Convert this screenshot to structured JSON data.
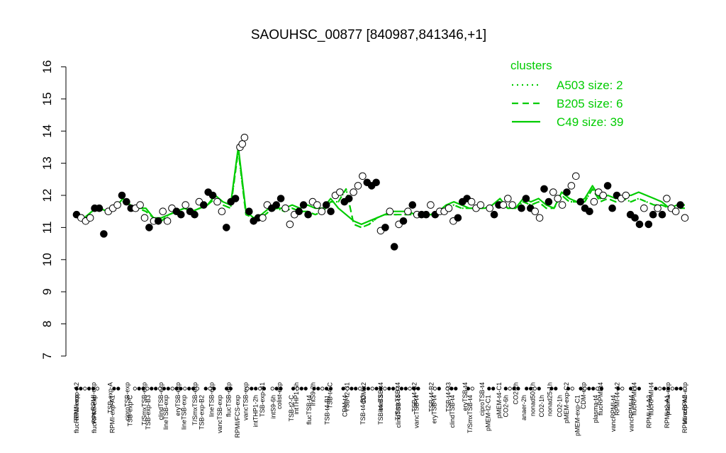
{
  "chart_data": {
    "type": "line",
    "title": "SAOUHSC_00877 [840987,841346,+1]",
    "xlabel": "",
    "ylabel": "",
    "ylim": [
      7,
      16
    ],
    "yticks": [
      7,
      8,
      9,
      10,
      11,
      12,
      13,
      14,
      15,
      16
    ],
    "grid": false,
    "legend": {
      "title": "clusters",
      "position": "top-right",
      "color": "#00cc00",
      "entries": [
        {
          "label": "A503 size: 2",
          "style": "dotted"
        },
        {
          "label": "B205 size: 6",
          "style": "dashed"
        },
        {
          "label": "C49 size: 39",
          "style": "solid"
        }
      ]
    },
    "top_labels": [
      "RPMI-exp-A2",
      "vancRPMI-exp",
      "TSB-exp-A",
      "ciproTSB-exp",
      "T/SmxTSB-exp",
      "clindTSB-exp",
      "eryTSB-exp",
      "T/SmxTSB-exp",
      "lineTSB-exp",
      "flucTSB-exp",
      "vancTSB-exp",
      "TSB-exp-B1",
      "colist-exp",
      "intTHP1-6h",
      "intS9-2h",
      "TSB-t4-C",
      "TSB-t2-B1",
      "CDM-t2",
      "lineTSB-t4",
      "T/SmxTSB-t4",
      "TSB-t4-B2",
      "TSB-t4-B2",
      "TSB-t4-B3",
      "eryTSB-t4",
      "ciproTSB-t4",
      "pMEM-t4-C1",
      "CO2-2h",
      "nonad50-1h",
      "nonad25-1h",
      "pMEM-exp-C2",
      "CDM-exp",
      "flucRPMI-t4",
      "RPMI-t4-A2",
      "flucRPMI-t4",
      "flucRPMI-t4",
      "plasma-exp",
      "vancRPMI-exp"
    ],
    "bottom_labels": [
      "flucRPMI-exp",
      "flucRPMI-exp",
      "RPMI-exp-A1",
      "TSB-exp-C",
      "TSB-exp-B3",
      "lineTSB-exp",
      "lineTSB-exp",
      "TSB-exp-B2",
      "vancTSB-exp",
      "RPMI/FCS-exp",
      "intTHP1-2h",
      "intS9-6h",
      "TSB-t2-C",
      "flucTSB-t4",
      "TSB-t4-B1",
      "CDM-t4",
      "TSB-t4-B3",
      "TSB-t4-B3",
      "clindTSB-t4",
      "vancTSB-t4",
      "eryTSB-t4",
      "clindTSB-t4",
      "T/SmxTSB-t4",
      "pMEM-t2-C1",
      "CO2-6h",
      "anaer-2h",
      "CO2-1h",
      "CO2-1h",
      "pMEM-exp-C1",
      "plasma-t4",
      "vancRPMI-t4",
      "vancRPMI-t4",
      "RPMI-t4-A2",
      "RPMI-t2-A1",
      "RPMI-exp-A2"
    ],
    "series": [
      {
        "style": "solid",
        "values": [
          11.4,
          11.3,
          11.5,
          11.6,
          11.5,
          11.6,
          11.9,
          11.7,
          11.6,
          11.6,
          11.3,
          11.3,
          11.4,
          11.5,
          11.6,
          11.5,
          11.6,
          11.7,
          12.0,
          11.8,
          11.7,
          13.5,
          11.5,
          11.3,
          11.4,
          11.6,
          11.6,
          11.6,
          11.7,
          11.6,
          11.7,
          11.6,
          11.6,
          11.9,
          11.6,
          11.4,
          11.2,
          11.1,
          11.2,
          11.3,
          11.4,
          11.5,
          11.5,
          11.5,
          11.4,
          11.4,
          11.4,
          11.5,
          11.7,
          11.8,
          11.7,
          11.6,
          11.6,
          11.6,
          11.7,
          11.9,
          11.6,
          11.6,
          11.9,
          11.8,
          11.9,
          11.7,
          11.6,
          12.1,
          11.9,
          11.8,
          11.9,
          12.3,
          11.9,
          12.0,
          11.9,
          12.0,
          12.0,
          12.1,
          12.0,
          11.9,
          11.8,
          11.6,
          11.7,
          11.7
        ]
      },
      {
        "style": "dashed",
        "values": [
          11.4,
          11.3,
          11.5,
          11.6,
          11.5,
          11.6,
          11.8,
          11.7,
          11.6,
          11.5,
          11.3,
          11.2,
          11.4,
          11.5,
          11.6,
          11.5,
          11.6,
          11.7,
          11.9,
          11.7,
          11.6,
          13.4,
          11.4,
          11.3,
          11.3,
          11.5,
          11.6,
          11.5,
          11.6,
          11.5,
          11.5,
          11.4,
          11.5,
          11.8,
          11.8,
          12.2,
          11.1,
          11.0,
          11.1,
          11.3,
          11.4,
          11.4,
          11.4,
          11.4,
          11.4,
          11.4,
          11.4,
          11.5,
          11.6,
          11.7,
          11.6,
          11.6,
          11.6,
          11.6,
          11.6,
          11.8,
          11.6,
          11.6,
          11.8,
          11.7,
          11.8,
          11.6,
          11.6,
          12.0,
          11.8,
          11.8,
          11.8,
          12.2,
          11.8,
          11.9,
          11.8,
          11.9,
          11.8,
          11.9,
          11.8,
          11.7,
          11.7,
          11.6,
          11.6,
          11.6
        ]
      },
      {
        "style": "dotted",
        "values": [
          11.4,
          11.3,
          11.5,
          11.6,
          11.5,
          11.6,
          11.8,
          11.7,
          11.6,
          11.5,
          11.3,
          11.2,
          11.4,
          11.5,
          11.6,
          11.5,
          11.6,
          11.7,
          11.9,
          11.7,
          11.6,
          13.4,
          11.4,
          11.3,
          11.3,
          11.5,
          11.6,
          11.5,
          11.6,
          11.5,
          11.5,
          11.4,
          11.5,
          11.8,
          11.8,
          12.2,
          11.1,
          11.0,
          11.1,
          11.3,
          11.4,
          11.4,
          11.4,
          11.4,
          11.4,
          11.4,
          11.4,
          11.5,
          11.6,
          11.7,
          11.6,
          11.6,
          11.6,
          11.6,
          11.6,
          11.8,
          11.6,
          11.6,
          11.8,
          11.7,
          11.8,
          11.6,
          11.6,
          12.0,
          11.8,
          11.8,
          11.8,
          12.2,
          11.8,
          11.9,
          11.8,
          11.9,
          11.8,
          11.9,
          11.8,
          11.7,
          11.7,
          11.6,
          11.6,
          11.6
        ]
      }
    ],
    "points": [
      {
        "x": 1,
        "y": 11.4,
        "f": 1
      },
      {
        "x": 2,
        "y": 11.3,
        "f": 0
      },
      {
        "x": 3,
        "y": 11.2,
        "f": 0
      },
      {
        "x": 4,
        "y": 11.3,
        "f": 0
      },
      {
        "x": 5,
        "y": 11.6,
        "f": 1
      },
      {
        "x": 6,
        "y": 11.6,
        "f": 1
      },
      {
        "x": 7,
        "y": 10.8,
        "f": 1
      },
      {
        "x": 8,
        "y": 11.5,
        "f": 0
      },
      {
        "x": 9,
        "y": 11.6,
        "f": 0
      },
      {
        "x": 10,
        "y": 11.7,
        "f": 0
      },
      {
        "x": 11,
        "y": 12.0,
        "f": 1
      },
      {
        "x": 12,
        "y": 11.8,
        "f": 1
      },
      {
        "x": 13,
        "y": 11.6,
        "f": 1
      },
      {
        "x": 14,
        "y": 11.6,
        "f": 0
      },
      {
        "x": 15,
        "y": 11.7,
        "f": 0
      },
      {
        "x": 16,
        "y": 11.3,
        "f": 0
      },
      {
        "x": 17,
        "y": 11.0,
        "f": 1
      },
      {
        "x": 18,
        "y": 11.2,
        "f": 0
      },
      {
        "x": 19,
        "y": 11.2,
        "f": 1
      },
      {
        "x": 20,
        "y": 11.5,
        "f": 0
      },
      {
        "x": 21,
        "y": 11.2,
        "f": 0
      },
      {
        "x": 22,
        "y": 11.6,
        "f": 0
      },
      {
        "x": 23,
        "y": 11.5,
        "f": 1
      },
      {
        "x": 24,
        "y": 11.4,
        "f": 1
      },
      {
        "x": 25,
        "y": 11.7,
        "f": 0
      },
      {
        "x": 26,
        "y": 11.5,
        "f": 1
      },
      {
        "x": 27,
        "y": 11.4,
        "f": 1
      },
      {
        "x": 28,
        "y": 11.8,
        "f": 0
      },
      {
        "x": 29,
        "y": 11.7,
        "f": 1
      },
      {
        "x": 30,
        "y": 12.1,
        "f": 1
      },
      {
        "x": 31,
        "y": 12.0,
        "f": 1
      },
      {
        "x": 32,
        "y": 11.8,
        "f": 0
      },
      {
        "x": 33,
        "y": 11.5,
        "f": 0
      },
      {
        "x": 34,
        "y": 11.0,
        "f": 1
      },
      {
        "x": 35,
        "y": 11.8,
        "f": 1
      },
      {
        "x": 36,
        "y": 11.9,
        "f": 1
      },
      {
        "x": 37,
        "y": 13.5,
        "f": 0
      },
      {
        "x": 37.5,
        "y": 13.6,
        "f": 0
      },
      {
        "x": 38,
        "y": 13.8,
        "f": 0
      },
      {
        "x": 39,
        "y": 11.5,
        "f": 1
      },
      {
        "x": 40,
        "y": 11.2,
        "f": 1
      },
      {
        "x": 41,
        "y": 11.3,
        "f": 1
      },
      {
        "x": 42,
        "y": 11.3,
        "f": 0
      },
      {
        "x": 43,
        "y": 11.7,
        "f": 0
      },
      {
        "x": 44,
        "y": 11.6,
        "f": 1
      },
      {
        "x": 45,
        "y": 11.7,
        "f": 1
      },
      {
        "x": 46,
        "y": 11.9,
        "f": 1
      },
      {
        "x": 47,
        "y": 11.6,
        "f": 0
      },
      {
        "x": 48,
        "y": 11.1,
        "f": 0
      },
      {
        "x": 49,
        "y": 11.4,
        "f": 0
      },
      {
        "x": 50,
        "y": 11.5,
        "f": 1
      },
      {
        "x": 51,
        "y": 11.7,
        "f": 1
      },
      {
        "x": 52,
        "y": 11.4,
        "f": 1
      },
      {
        "x": 53,
        "y": 11.8,
        "f": 0
      },
      {
        "x": 54,
        "y": 11.7,
        "f": 0
      },
      {
        "x": 55,
        "y": 11.5,
        "f": 0
      },
      {
        "x": 56,
        "y": 11.7,
        "f": 1
      },
      {
        "x": 57,
        "y": 11.5,
        "f": 1
      },
      {
        "x": 58,
        "y": 12.0,
        "f": 0
      },
      {
        "x": 59,
        "y": 12.1,
        "f": 0
      },
      {
        "x": 60,
        "y": 11.8,
        "f": 1
      },
      {
        "x": 61,
        "y": 11.9,
        "f": 1
      },
      {
        "x": 62,
        "y": 12.1,
        "f": 0
      },
      {
        "x": 63,
        "y": 12.3,
        "f": 0
      },
      {
        "x": 64,
        "y": 12.6,
        "f": 0
      },
      {
        "x": 65,
        "y": 12.4,
        "f": 1
      },
      {
        "x": 66,
        "y": 12.3,
        "f": 1
      },
      {
        "x": 67,
        "y": 12.4,
        "f": 1
      },
      {
        "x": 68,
        "y": 10.9,
        "f": 0
      },
      {
        "x": 69,
        "y": 11.0,
        "f": 1
      },
      {
        "x": 70,
        "y": 11.5,
        "f": 0
      },
      {
        "x": 71,
        "y": 10.4,
        "f": 1
      },
      {
        "x": 72,
        "y": 11.1,
        "f": 0
      },
      {
        "x": 73,
        "y": 11.2,
        "f": 1
      },
      {
        "x": 74,
        "y": 11.5,
        "f": 0
      },
      {
        "x": 75,
        "y": 11.7,
        "f": 1
      },
      {
        "x": 76,
        "y": 11.4,
        "f": 0
      },
      {
        "x": 77,
        "y": 11.4,
        "f": 1
      },
      {
        "x": 78,
        "y": 11.4,
        "f": 1
      },
      {
        "x": 79,
        "y": 11.7,
        "f": 0
      },
      {
        "x": 80,
        "y": 11.4,
        "f": 1
      },
      {
        "x": 81,
        "y": 11.5,
        "f": 0
      },
      {
        "x": 82,
        "y": 11.5,
        "f": 0
      },
      {
        "x": 83,
        "y": 11.6,
        "f": 0
      },
      {
        "x": 84,
        "y": 11.2,
        "f": 0
      },
      {
        "x": 85,
        "y": 11.3,
        "f": 1
      },
      {
        "x": 86,
        "y": 11.8,
        "f": 1
      },
      {
        "x": 87,
        "y": 11.9,
        "f": 1
      },
      {
        "x": 88,
        "y": 11.8,
        "f": 0
      },
      {
        "x": 89,
        "y": 11.6,
        "f": 0
      },
      {
        "x": 90,
        "y": 11.7,
        "f": 0
      },
      {
        "x": 92,
        "y": 11.6,
        "f": 0
      },
      {
        "x": 93,
        "y": 11.4,
        "f": 1
      },
      {
        "x": 94,
        "y": 11.7,
        "f": 1
      },
      {
        "x": 95,
        "y": 11.7,
        "f": 0
      },
      {
        "x": 96,
        "y": 11.9,
        "f": 0
      },
      {
        "x": 97,
        "y": 11.7,
        "f": 0
      },
      {
        "x": 99,
        "y": 11.6,
        "f": 1
      },
      {
        "x": 100,
        "y": 11.9,
        "f": 1
      },
      {
        "x": 101,
        "y": 11.6,
        "f": 1
      },
      {
        "x": 102,
        "y": 11.5,
        "f": 0
      },
      {
        "x": 103,
        "y": 11.3,
        "f": 0
      },
      {
        "x": 104,
        "y": 12.2,
        "f": 1
      },
      {
        "x": 105,
        "y": 11.8,
        "f": 1
      },
      {
        "x": 106,
        "y": 12.1,
        "f": 0
      },
      {
        "x": 107,
        "y": 11.9,
        "f": 0
      },
      {
        "x": 108,
        "y": 11.7,
        "f": 0
      },
      {
        "x": 109,
        "y": 12.1,
        "f": 1
      },
      {
        "x": 110,
        "y": 12.3,
        "f": 0
      },
      {
        "x": 111,
        "y": 12.6,
        "f": 0
      },
      {
        "x": 112,
        "y": 11.8,
        "f": 1
      },
      {
        "x": 113,
        "y": 11.6,
        "f": 1
      },
      {
        "x": 114,
        "y": 11.5,
        "f": 1
      },
      {
        "x": 115,
        "y": 11.8,
        "f": 0
      },
      {
        "x": 116,
        "y": 12.1,
        "f": 0
      },
      {
        "x": 117,
        "y": 12.0,
        "f": 0
      },
      {
        "x": 118,
        "y": 12.3,
        "f": 1
      },
      {
        "x": 119,
        "y": 11.6,
        "f": 1
      },
      {
        "x": 120,
        "y": 12.0,
        "f": 1
      },
      {
        "x": 121,
        "y": 11.9,
        "f": 0
      },
      {
        "x": 122,
        "y": 12.0,
        "f": 0
      },
      {
        "x": 123,
        "y": 11.4,
        "f": 1
      },
      {
        "x": 124,
        "y": 11.3,
        "f": 1
      },
      {
        "x": 125,
        "y": 11.1,
        "f": 1
      },
      {
        "x": 126,
        "y": 11.6,
        "f": 0
      },
      {
        "x": 127,
        "y": 11.1,
        "f": 1
      },
      {
        "x": 128,
        "y": 11.4,
        "f": 1
      },
      {
        "x": 129,
        "y": 11.6,
        "f": 0
      },
      {
        "x": 130,
        "y": 11.4,
        "f": 1
      },
      {
        "x": 131,
        "y": 11.9,
        "f": 0
      },
      {
        "x": 132,
        "y": 11.6,
        "f": 0
      },
      {
        "x": 133,
        "y": 11.5,
        "f": 0
      },
      {
        "x": 134,
        "y": 11.7,
        "f": 1
      },
      {
        "x": 135,
        "y": 11.3,
        "f": 0
      }
    ],
    "dot_groups": [
      [
        1,
        6
      ],
      [
        10,
        11
      ],
      [
        15,
        17
      ],
      [
        18,
        26
      ],
      [
        27,
        30
      ],
      [
        32,
        34
      ],
      [
        37,
        38
      ],
      [
        42,
        44
      ],
      [
        45,
        46
      ],
      [
        48,
        50
      ],
      [
        53,
        56
      ],
      [
        58,
        62
      ],
      [
        65,
        70
      ],
      [
        71,
        75
      ],
      [
        76,
        83
      ],
      [
        87,
        88
      ],
      [
        90,
        92
      ],
      [
        95,
        96
      ],
      [
        100,
        101
      ],
      [
        104,
        107
      ],
      [
        109,
        112
      ],
      [
        115,
        116
      ],
      [
        119,
        120
      ],
      [
        122,
        127
      ],
      [
        131,
        132
      ],
      [
        134,
        136
      ],
      [
        140,
        142
      ],
      [
        143,
        147
      ]
    ]
  }
}
